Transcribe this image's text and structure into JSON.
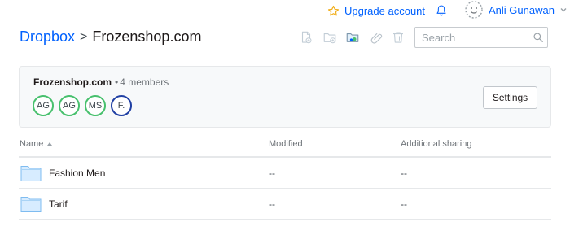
{
  "topbar": {
    "upgrade_label": "Upgrade account",
    "user_name": "Anli Gunawan"
  },
  "breadcrumb": {
    "root": "Dropbox",
    "separator": ">",
    "current": "Frozenshop.com"
  },
  "toolbar": {
    "icons": [
      "upload-file-icon",
      "new-folder-icon",
      "shared-folder-icon",
      "link-icon",
      "delete-icon"
    ]
  },
  "search": {
    "placeholder": "Search"
  },
  "panel": {
    "folder_name": "Frozenshop.com",
    "members_text": "4 members",
    "avatars": [
      "AG",
      "AG",
      "MS",
      "F."
    ],
    "settings_label": "Settings"
  },
  "table": {
    "columns": {
      "name": "Name",
      "modified": "Modified",
      "sharing": "Additional sharing"
    },
    "rows": [
      {
        "name": "Fashion Men",
        "modified": "--",
        "sharing": "--"
      },
      {
        "name": "Tarif",
        "modified": "--",
        "sharing": "--"
      }
    ]
  },
  "colors": {
    "accent": "#0061fe",
    "member_border": "#47c06d",
    "member_border_alt": "#1f3fa3",
    "folder": "#92ceff"
  }
}
